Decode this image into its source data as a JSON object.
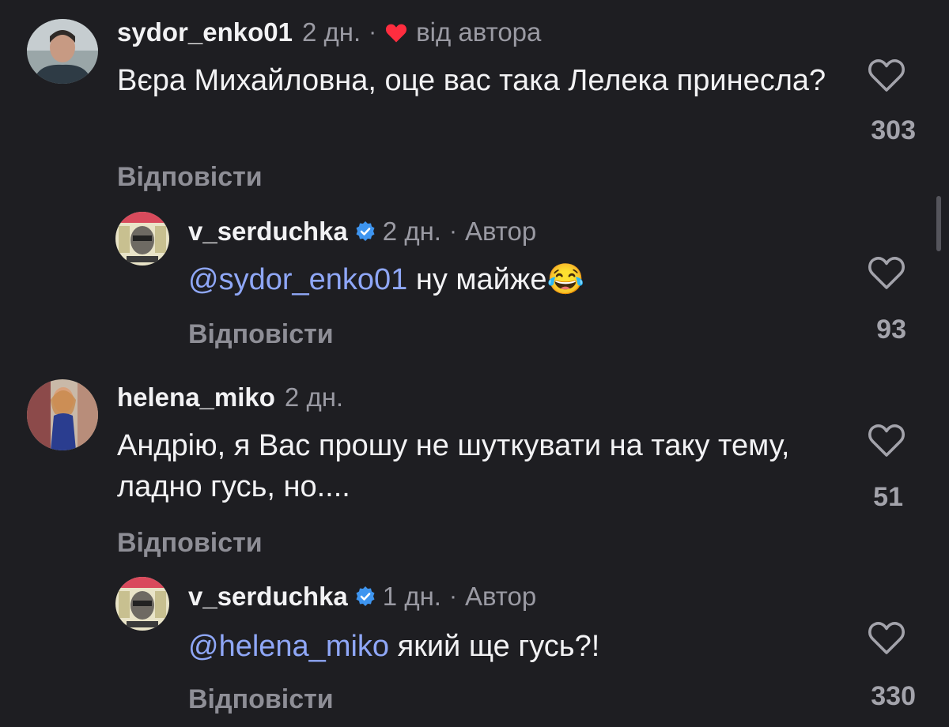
{
  "colors": {
    "background": "#1e1e22",
    "mention": "#8fa7f7",
    "heart_red": "#ff2d3f",
    "verified_blue": "#3e95f0"
  },
  "comments": [
    {
      "username": "sydor_enko01",
      "time": "2 дн.",
      "separator": "·",
      "author_liked_label": "від автора",
      "text": "Вєра Михайловна, оце вас така Лелека принесла?",
      "reply_label": "Відповісти",
      "likes": "303",
      "avatar_icon": "user-avatar"
    },
    {
      "username": "v_serduchka",
      "time": "2 дн.",
      "separator": "·",
      "author_tag": "Автор",
      "mention": "@sydor_enko01",
      "text": " ну майже",
      "emoji": "😂",
      "reply_label": "Відповісти",
      "likes": "93",
      "avatar_icon": "user-avatar"
    },
    {
      "username": "helena_miko",
      "time": "2 дн.",
      "text": "Андрію, я Вас прошу не шуткувати на таку тему, ладно гусь, но....",
      "reply_label": "Відповісти",
      "likes": "51",
      "avatar_icon": "user-avatar"
    },
    {
      "username": "v_serduchka",
      "time": "1 дн.",
      "separator": "·",
      "author_tag": "Автор",
      "mention": "@helena_miko",
      "text": " який ще гусь?!",
      "reply_label": "Відповісти",
      "likes": "330",
      "avatar_icon": "user-avatar"
    }
  ]
}
